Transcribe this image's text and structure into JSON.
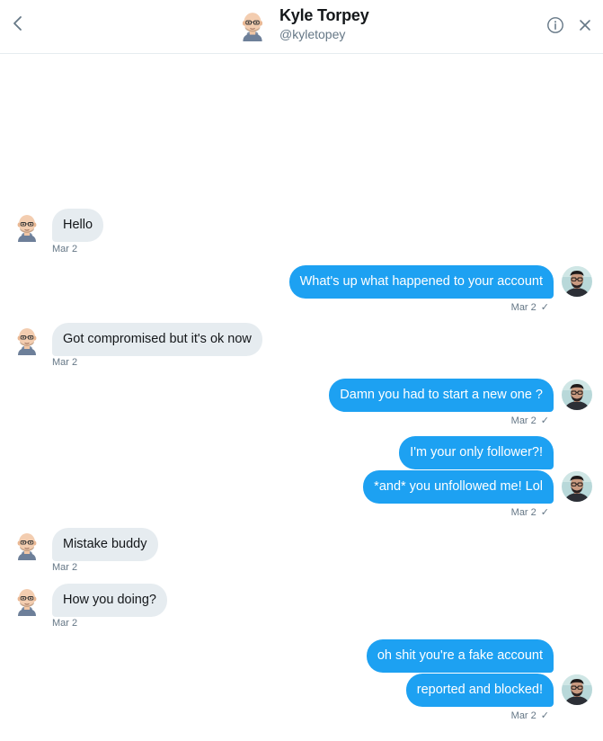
{
  "header": {
    "name": "Kyle Torpey",
    "handle": "@kyletopey"
  },
  "icons": {
    "back": "chevron-left-icon",
    "info": "info-icon",
    "close": "close-icon"
  },
  "colors": {
    "outgoing_bubble": "#1da1f2",
    "incoming_bubble": "#e6ecf0",
    "meta_text": "#657786"
  },
  "messages": [
    {
      "direction": "incoming",
      "text": "Hello",
      "time": "Mar 2"
    },
    {
      "direction": "outgoing",
      "text": "What's up what happened to your account",
      "time": "Mar 2",
      "read_mark": "✓"
    },
    {
      "direction": "incoming",
      "text": "Got compromised but it's ok now",
      "time": "Mar 2"
    },
    {
      "direction": "outgoing",
      "text": "Damn you had to start a new one ?",
      "time": "Mar 2",
      "read_mark": "✓"
    },
    {
      "direction": "outgoing",
      "text": "I'm your only follower?!"
    },
    {
      "direction": "outgoing",
      "text": "*and* you unfollowed me! Lol",
      "time": "Mar 2",
      "read_mark": "✓"
    },
    {
      "direction": "incoming",
      "text": "Mistake buddy",
      "time": "Mar 2"
    },
    {
      "direction": "incoming",
      "text": "How you doing?",
      "time": "Mar 2"
    },
    {
      "direction": "outgoing",
      "text": "oh shit you're a fake account"
    },
    {
      "direction": "outgoing",
      "text": "reported and blocked!",
      "time": "Mar 2",
      "read_mark": "✓"
    }
  ]
}
